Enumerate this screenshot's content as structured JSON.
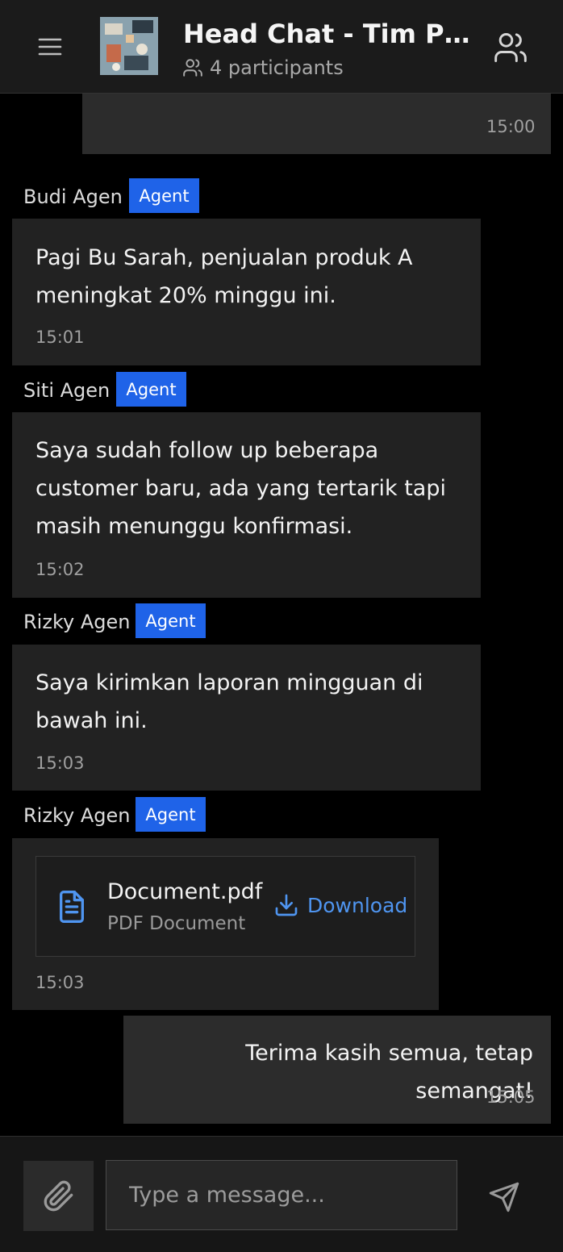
{
  "header": {
    "title": "Head Chat - Tim Penjualan",
    "participants": "4 participants"
  },
  "messages": [
    {
      "time": "15:00"
    },
    {
      "sender": "Budi Agen",
      "role": "Agent",
      "text": "Pagi Bu Sarah, penjualan produk A meningkat 20% minggu ini.",
      "time": "15:01"
    },
    {
      "sender": "Siti Agen",
      "role": "Agent",
      "text": "Saya sudah follow up beberapa customer baru, ada yang tertarik tapi masih menunggu konfirmasi.",
      "time": "15:02"
    },
    {
      "sender": "Rizky Agen",
      "role": "Agent",
      "text": "Saya kirimkan laporan mingguan di bawah ini.",
      "time": "15:03"
    },
    {
      "sender": "Rizky Agen",
      "role": "Agent",
      "file_name": "Document.pdf",
      "file_type": "PDF Document",
      "download_label": "Download",
      "time": "15:03"
    },
    {
      "text": "Terima kasih semua, tetap semangat!",
      "time": "15:05"
    }
  ],
  "composer": {
    "placeholder": "Type a message..."
  },
  "colors": {
    "badge": "#1f63e8",
    "link": "#4f95f0",
    "background": "#000000"
  }
}
